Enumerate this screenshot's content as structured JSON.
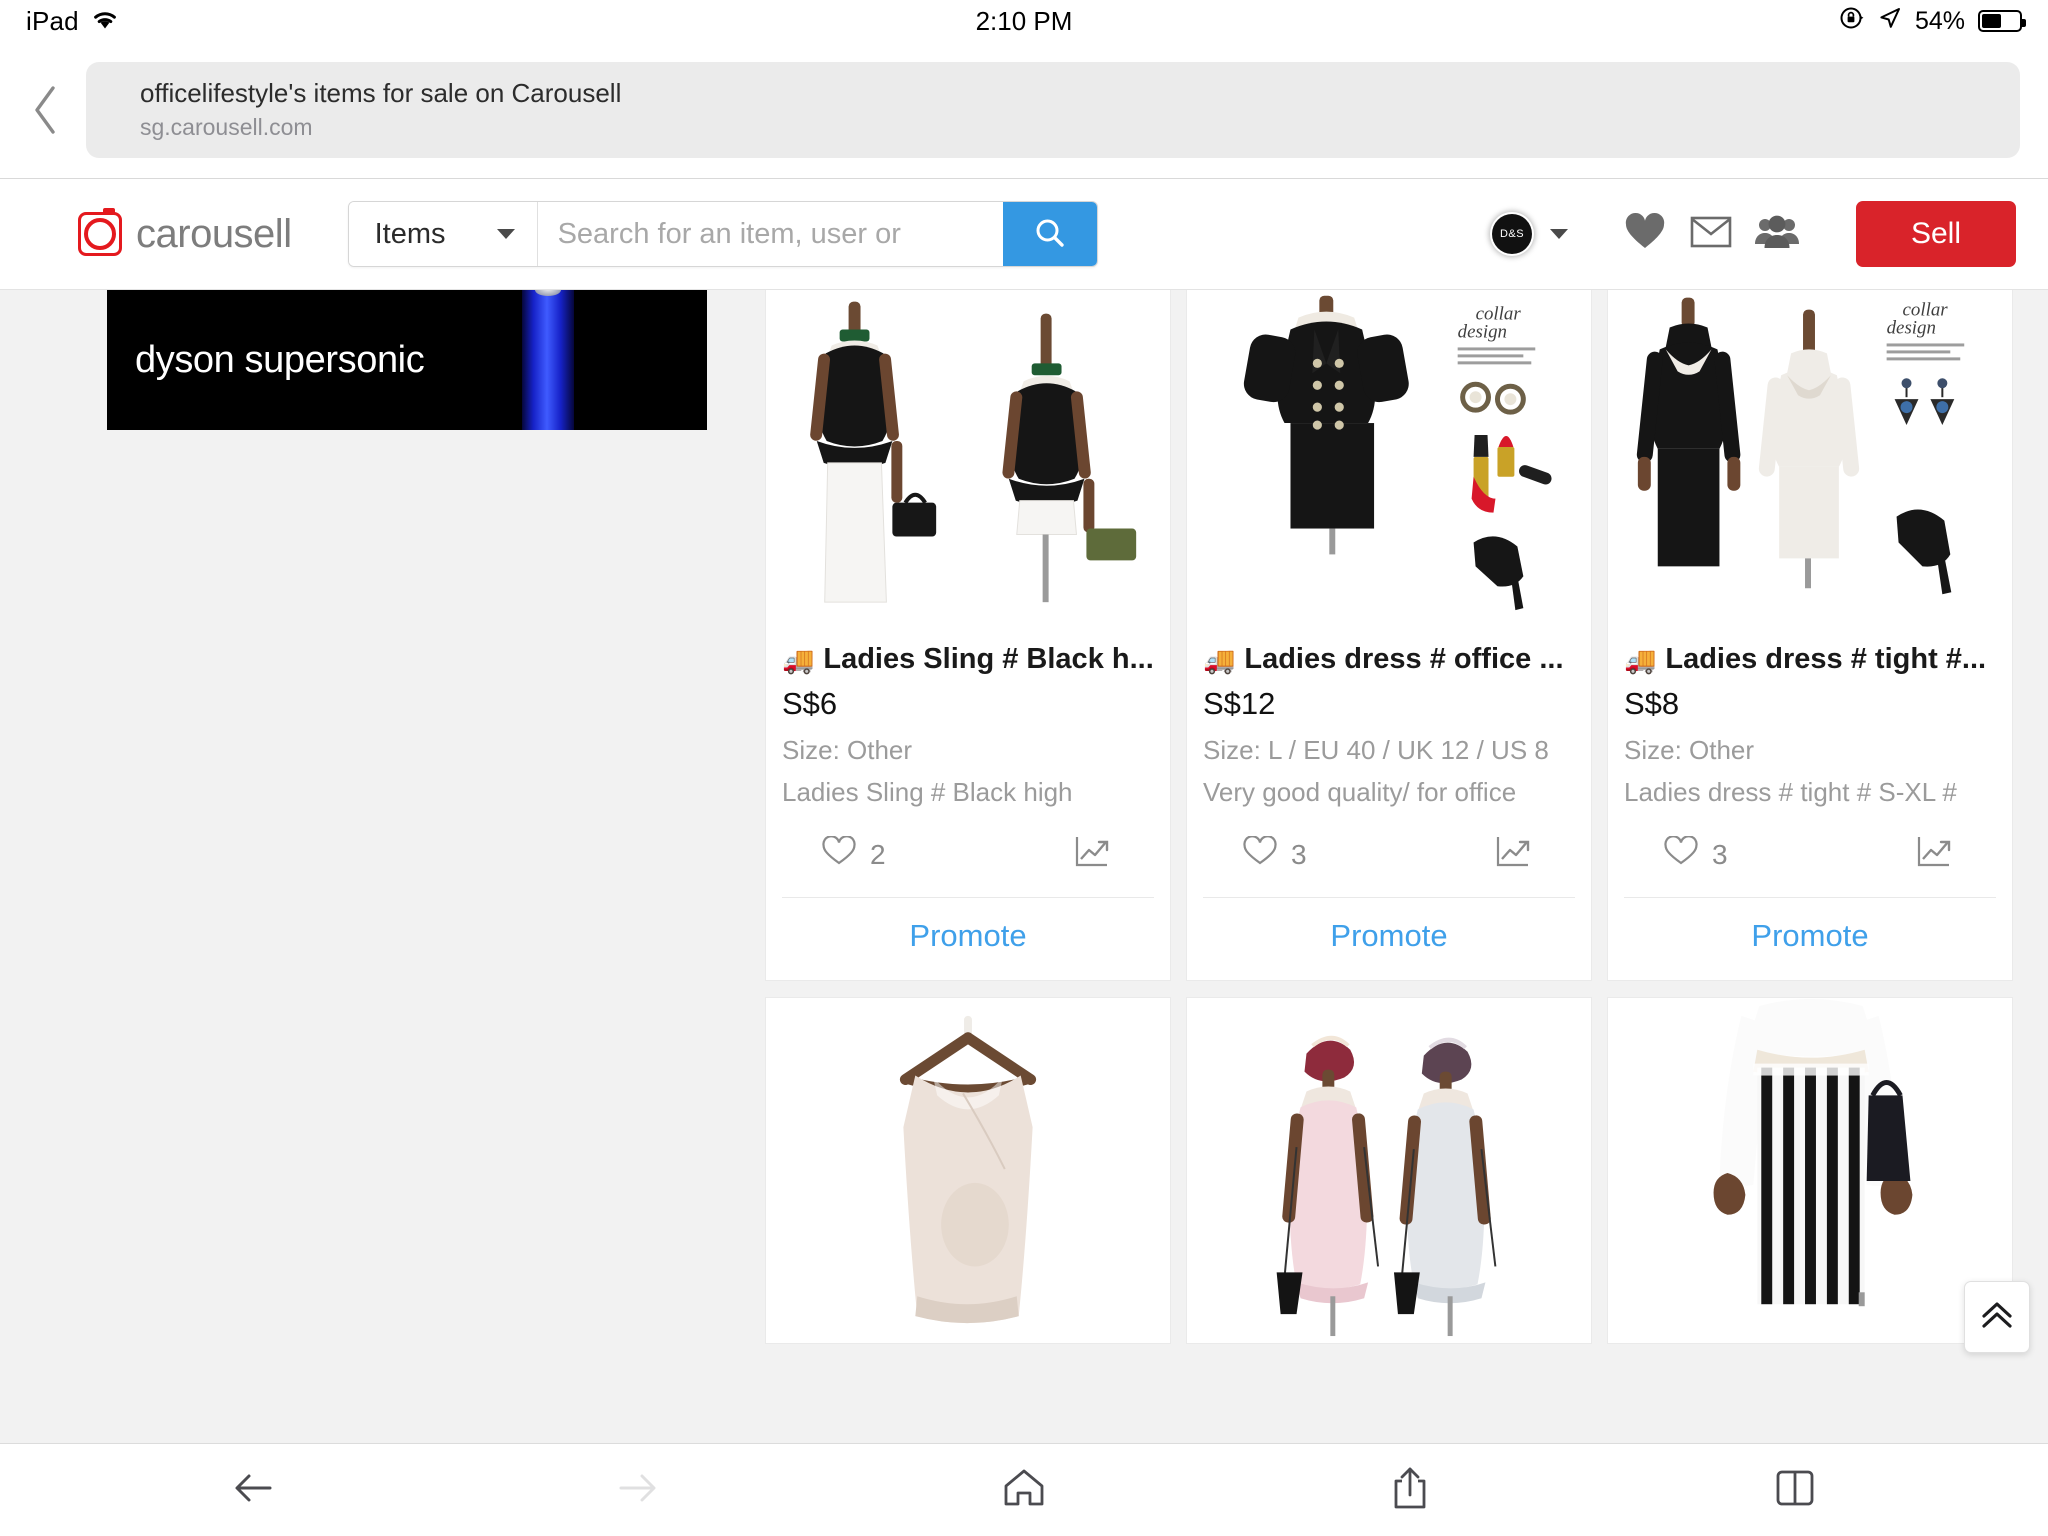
{
  "status_bar": {
    "device": "iPad",
    "wifi_icon": "wifi-icon",
    "time": "2:10 PM",
    "rotation_lock_icon": "rotation-lock-icon",
    "location_icon": "location-arrow-icon",
    "battery_percent": "54%",
    "battery_level": 54
  },
  "browser": {
    "back_icon": "chevron-left-icon",
    "url_title": "officelifestyle's items for sale on Carousell",
    "url_host": "sg.carousell.com",
    "bottom_toolbar": {
      "back_label": "back-arrow-icon",
      "forward_label": "forward-arrow-icon",
      "home_label": "home-icon",
      "share_label": "share-icon",
      "tabs_label": "tabs-icon"
    }
  },
  "site_header": {
    "brand_name": "carousell",
    "brand_color": "#e4191e",
    "category_selected": "Items",
    "search_placeholder": "Search for an item, user or",
    "search_value": "",
    "search_button_color": "#3498e2",
    "avatar_initials": "D&S",
    "icons": [
      "heart-icon",
      "envelope-icon",
      "group-icon"
    ],
    "sell_label": "Sell",
    "sell_color": "#d9232a"
  },
  "ad": {
    "text": "dyson supersonic",
    "background": "#000000"
  },
  "listings": [
    {
      "shipping_icon": "delivery-truck-icon",
      "title": "Ladies Sling # Black h...",
      "price": "S$6",
      "size": "Size: Other",
      "description": "Ladies Sling # Black high",
      "likes": "2",
      "stats_icon": "chart-trend-icon",
      "promote_label": "Promote"
    },
    {
      "shipping_icon": "delivery-truck-icon",
      "title": "Ladies dress # office ...",
      "price": "S$12",
      "size": "Size: L / EU 40 / UK 12 / US 8",
      "description": "Very good quality/ for office",
      "likes": "3",
      "stats_icon": "chart-trend-icon",
      "promote_label": "Promote"
    },
    {
      "shipping_icon": "delivery-truck-icon",
      "title": "Ladies dress # tight #...",
      "price": "S$8",
      "size": "Size: Other",
      "description": "Ladies dress # tight # S-XL #",
      "likes": "3",
      "stats_icon": "chart-trend-icon",
      "promote_label": "Promote"
    }
  ],
  "listings_row2": [
    {
      "image_alt": "beige-camisole-on-hanger"
    },
    {
      "image_alt": "pink-and-grey-tweed-dresses"
    },
    {
      "image_alt": "black-white-striped-palazzo-pants"
    }
  ],
  "image_notes": {
    "collar_script_line1": "collar",
    "collar_script_line2": "design"
  },
  "scroll_to_top_icon": "double-chevron-up-icon"
}
